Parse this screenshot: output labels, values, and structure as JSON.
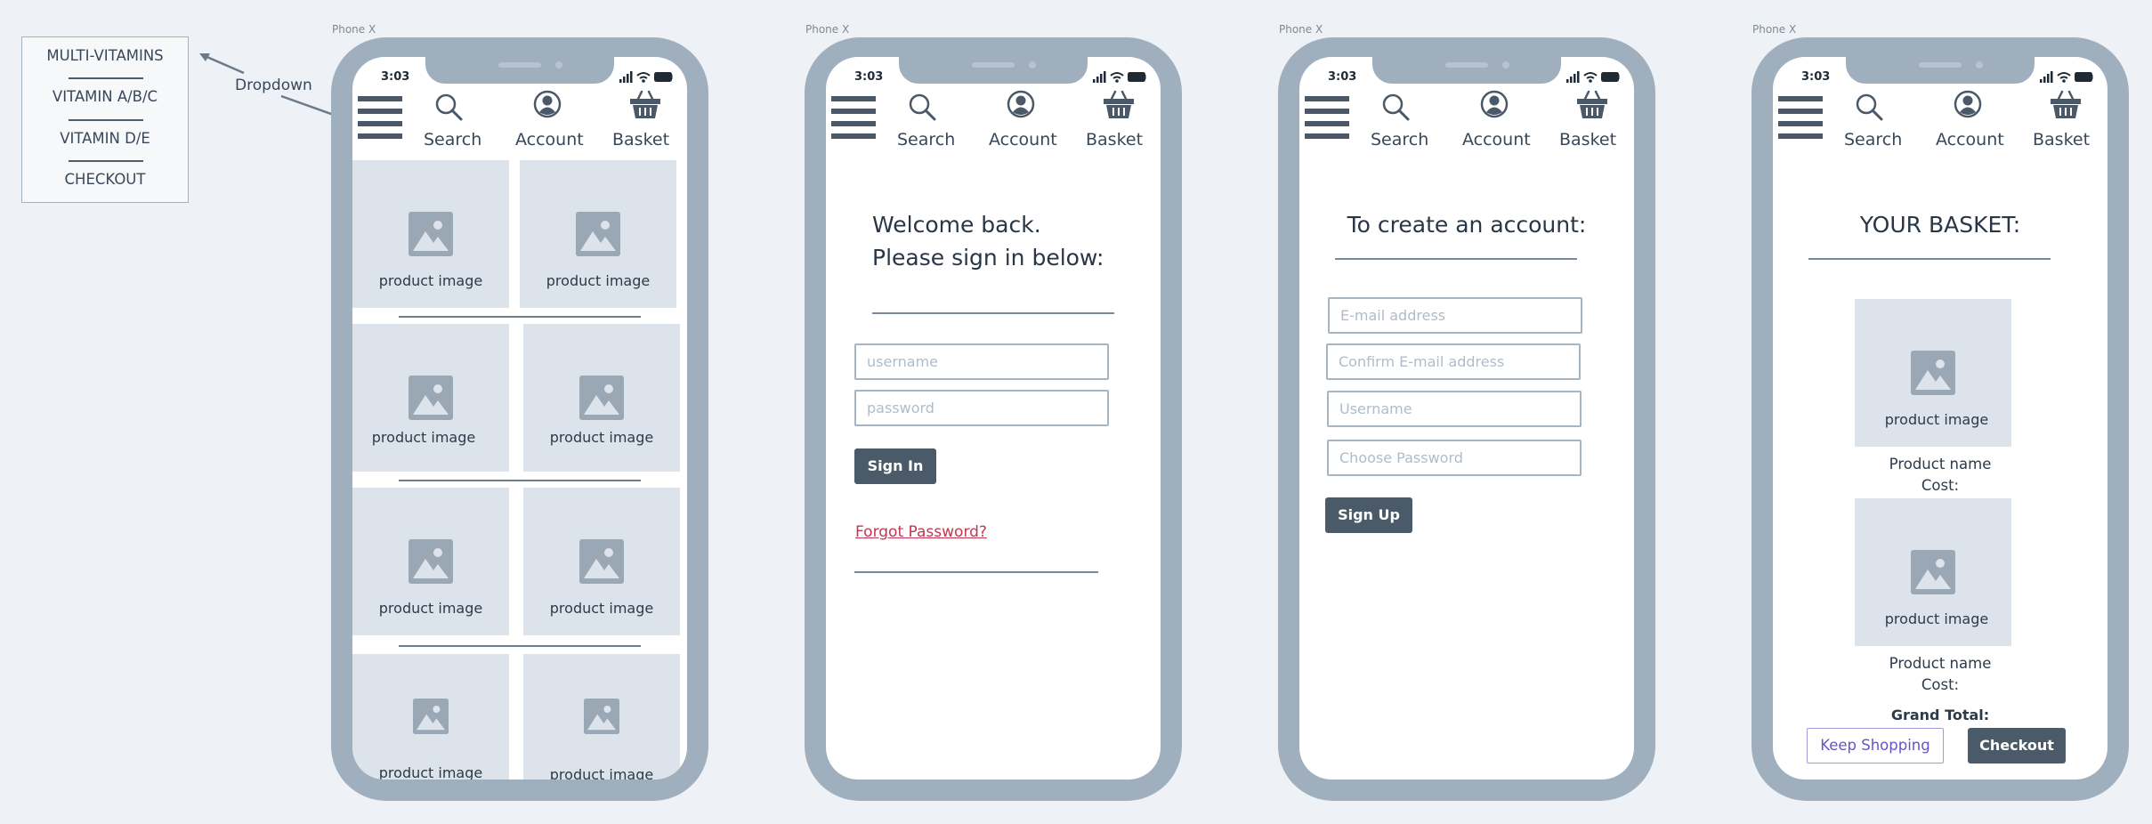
{
  "dropdown": {
    "label": "Dropdown",
    "items": [
      "MULTI-VITAMINS",
      "VITAMIN A/B/C",
      "VITAMIN D/E",
      "CHECKOUT"
    ]
  },
  "phones": [
    {
      "frame_label": "Phone X",
      "time": "3:03",
      "nav": {
        "search": "Search",
        "account": "Account",
        "basket": "Basket"
      },
      "tile_caption": "product image"
    },
    {
      "frame_label": "Phone X",
      "time": "3:03",
      "nav": {
        "search": "Search",
        "account": "Account",
        "basket": "Basket"
      },
      "welcome_line1": "Welcome back.",
      "welcome_line2": "Please sign in below:",
      "username_placeholder": "username",
      "password_placeholder": "password",
      "sign_in_label": "Sign In",
      "forgot_label": "Forgot Password?"
    },
    {
      "frame_label": "Phone X",
      "time": "3:03",
      "nav": {
        "search": "Search",
        "account": "Account",
        "basket": "Basket"
      },
      "heading": "To create an account:",
      "email_placeholder": "E-mail address",
      "confirm_email_placeholder": "Confirm E-mail address",
      "username_placeholder": "Username",
      "password_placeholder": "Choose Password",
      "sign_up_label": "Sign Up"
    },
    {
      "frame_label": "Phone X",
      "time": "3:03",
      "nav": {
        "search": "Search",
        "account": "Account",
        "basket": "Basket"
      },
      "heading": "YOUR BASKET:",
      "items": [
        {
          "image_caption": "product image",
          "name": "Product name",
          "cost": "Cost:"
        },
        {
          "image_caption": "product image",
          "name": "Product name",
          "cost": "Cost:"
        }
      ],
      "grand_total": "Grand Total:",
      "keep_shopping_label": "Keep Shopping",
      "checkout_label": "Checkout"
    }
  ],
  "colors": {
    "background": "#eef1f5",
    "phone_frame": "#9fafbd",
    "tile": "#dde3eb",
    "dark_button": "#4b5a69",
    "link_red": "#c4364f",
    "outline_purple": "#6356c4"
  }
}
